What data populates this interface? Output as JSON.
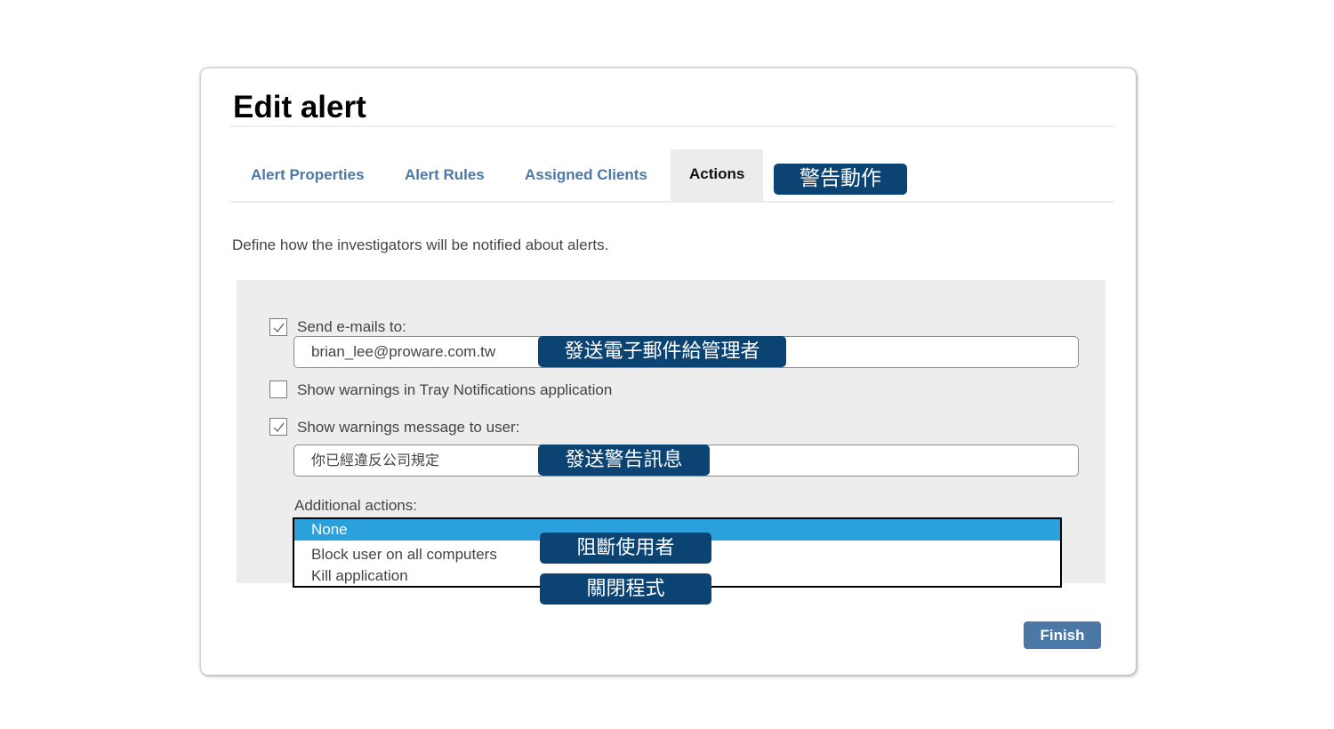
{
  "dialog": {
    "title": "Edit alert",
    "tabs": [
      {
        "label": "Alert Properties",
        "active": false
      },
      {
        "label": "Alert Rules",
        "active": false
      },
      {
        "label": "Assigned Clients",
        "active": false
      },
      {
        "label": "Actions",
        "active": true
      }
    ],
    "description": "Define how the investigators will be notified about alerts.",
    "send_email": {
      "checked": true,
      "label": "Send e-mails to:",
      "value": "brian_lee@proware.com.tw"
    },
    "tray_notifications": {
      "checked": false,
      "label": "Show warnings in Tray Notifications application"
    },
    "warning_message": {
      "checked": true,
      "label": "Show warnings message to user:",
      "value": "你已經違反公司規定"
    },
    "additional_actions": {
      "label": "Additional actions:",
      "options": [
        "None",
        "Block user on all computers",
        "Kill application"
      ],
      "selected": "None"
    },
    "finish_label": "Finish"
  },
  "annotations": {
    "actions_tab": "警告動作",
    "send_email": "發送電子郵件給管理者",
    "warning_message": "發送警告訊息",
    "block_user": "阻斷使用者",
    "kill_app": "關閉程式"
  },
  "colors": {
    "tab_link": "#4a78a8",
    "annotation_bg": "#0b4473",
    "selected_option": "#2aa0dc",
    "finish_button": "#4c78a8",
    "panel_bg": "#ededed"
  }
}
